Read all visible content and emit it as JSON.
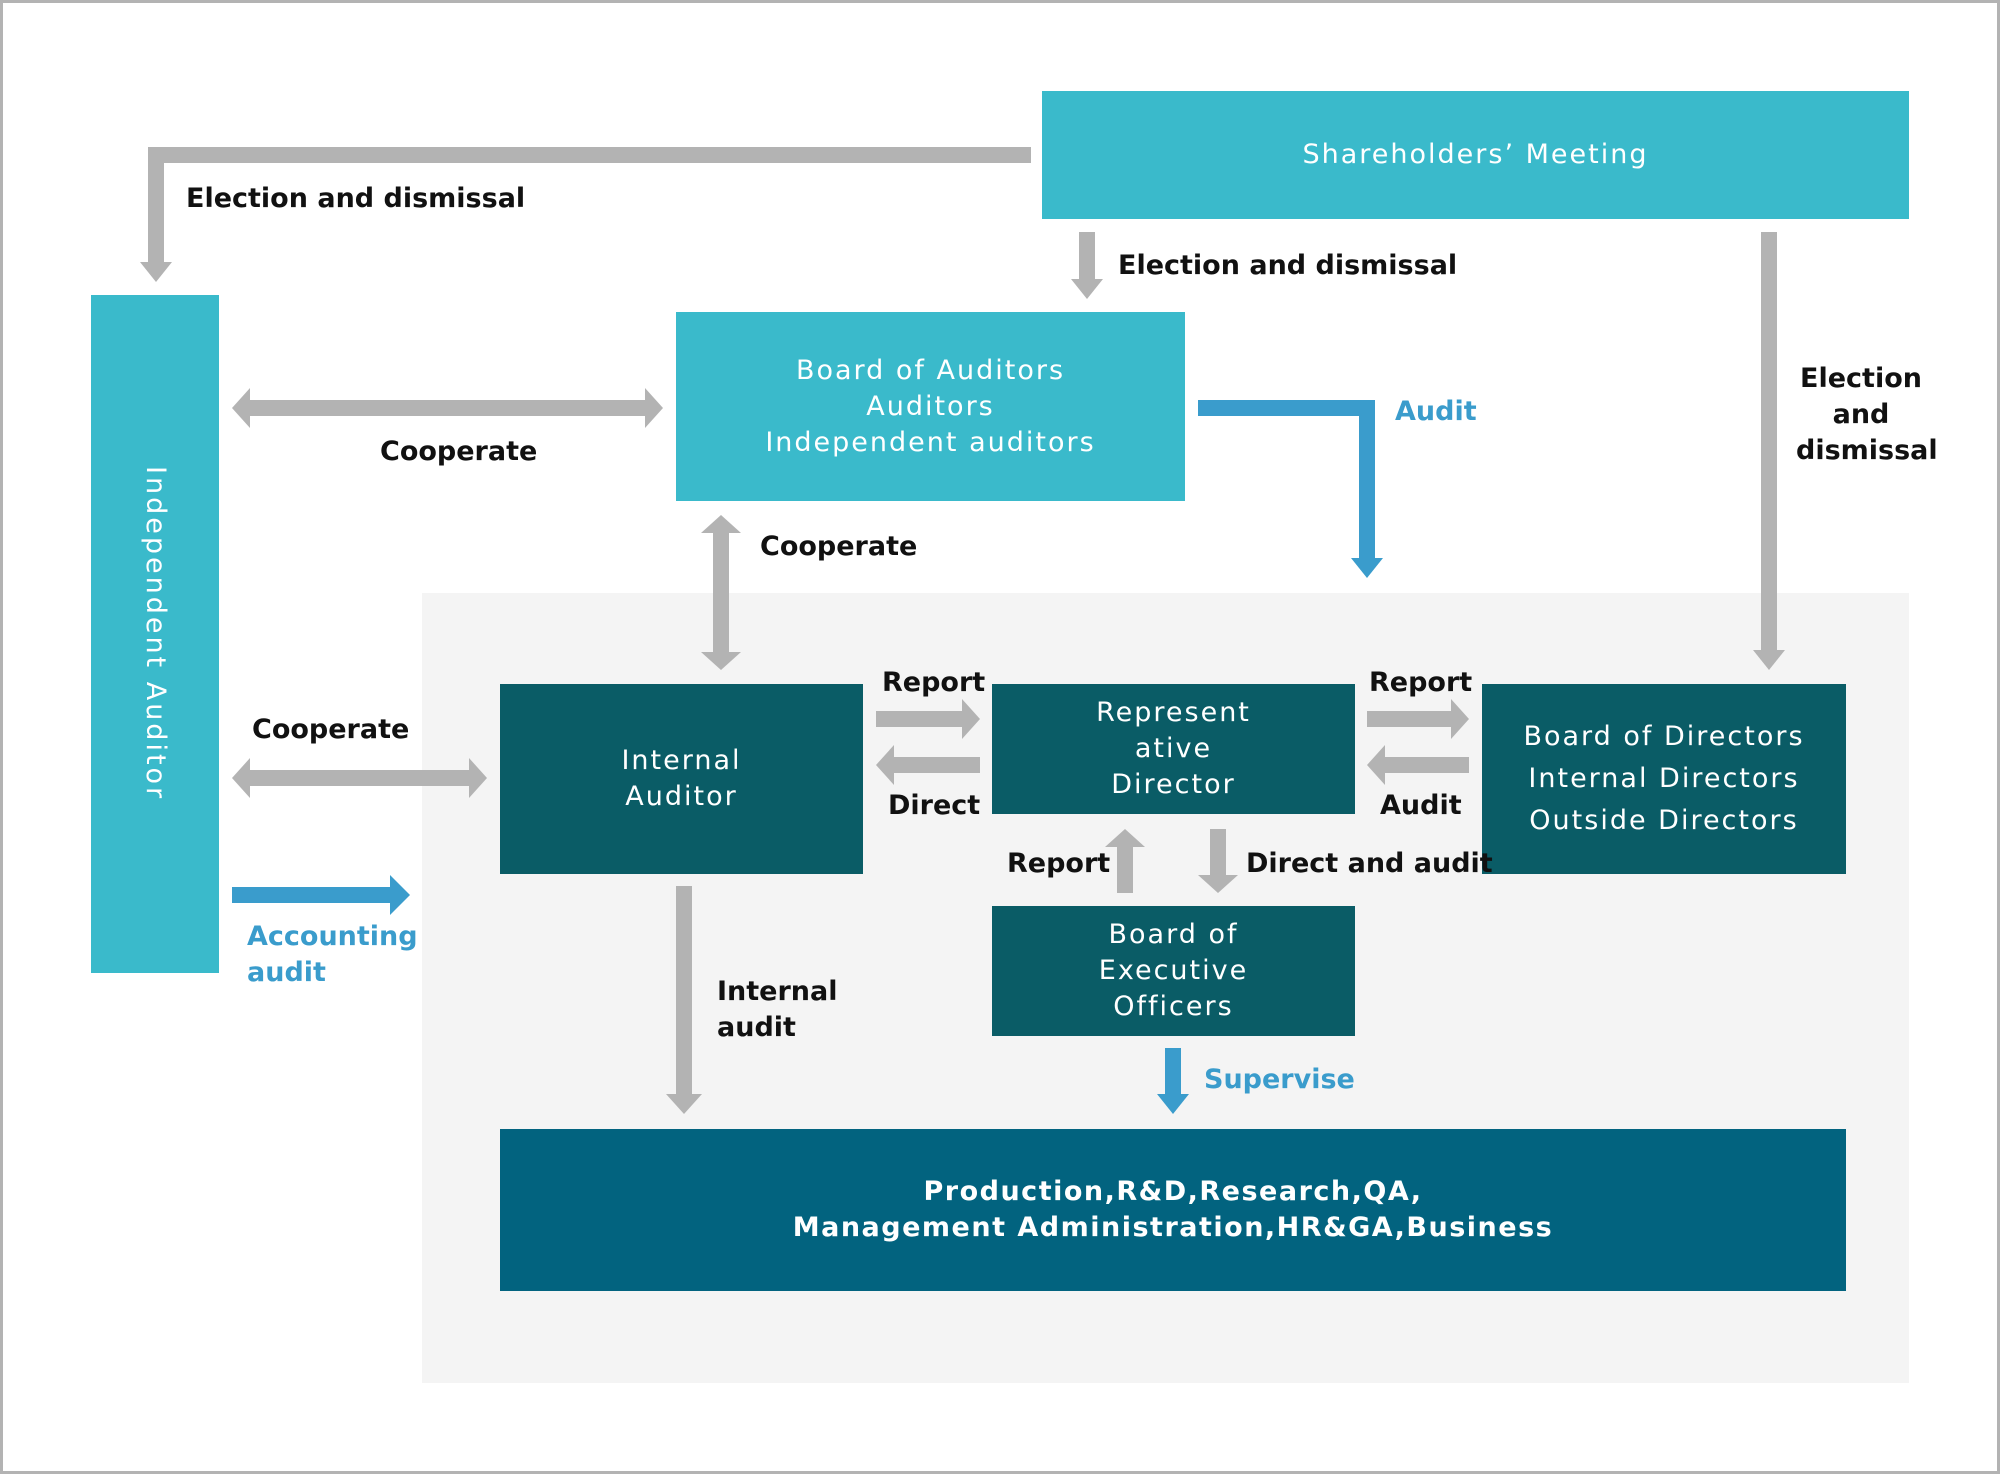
{
  "diagram": {
    "nodes": {
      "shareholders_meeting": {
        "label": "Shareholders’ Meeting"
      },
      "independent_auditor": {
        "label": "Independent Auditor"
      },
      "board_of_auditors": {
        "lines": [
          "Board of Auditors",
          "Auditors",
          "Independent auditors"
        ]
      },
      "internal_auditor": {
        "lines": [
          "Internal",
          "Auditor"
        ]
      },
      "representative_director": {
        "lines": [
          "Represent",
          "ative",
          "Director"
        ]
      },
      "board_of_directors": {
        "lines": [
          "Board of Directors",
          "Internal Directors",
          "Outside Directors"
        ]
      },
      "board_of_executive_officers": {
        "lines": [
          "Board of",
          "Executive",
          "Officers"
        ]
      },
      "business_units": {
        "lines": [
          "Production,R&D,Research,QA,",
          "Management Administration,HR&GA,Business"
        ]
      }
    },
    "edges": {
      "sh_to_independent_auditor": {
        "label": "Election and dismissal"
      },
      "sh_to_board_of_auditors": {
        "label": "Election and dismissal"
      },
      "sh_to_board_of_directors": {
        "lines": [
          "Election",
          "and",
          "dismissal"
        ]
      },
      "ia_boa_cooperate": {
        "label": "Cooperate"
      },
      "boa_audit": {
        "label": "Audit"
      },
      "boa_internal_cooperate": {
        "label": "Cooperate"
      },
      "ia_internal_cooperate": {
        "label": "Cooperate"
      },
      "accounting_audit": {
        "lines": [
          "Accounting",
          "audit"
        ]
      },
      "internal_to_rep_report": {
        "label": "Report"
      },
      "rep_to_internal_direct": {
        "label": "Direct"
      },
      "rep_to_bod_report": {
        "label": "Report"
      },
      "bod_to_rep_audit": {
        "label": "Audit"
      },
      "exec_to_rep_report": {
        "label": "Report"
      },
      "rep_to_exec_direct_audit": {
        "label": "Direct and audit"
      },
      "internal_audit": {
        "lines": [
          "Internal",
          "audit"
        ]
      },
      "supervise": {
        "label": "Supervise"
      }
    }
  },
  "colors": {
    "light_teal": "#3abacb",
    "dark_teal": "#0a5c66",
    "deep_blue": "#02637f",
    "arrow_gray": "#b3b3b3",
    "arrow_blue": "#3a9ccc",
    "panel_gray": "#f4f4f4"
  }
}
